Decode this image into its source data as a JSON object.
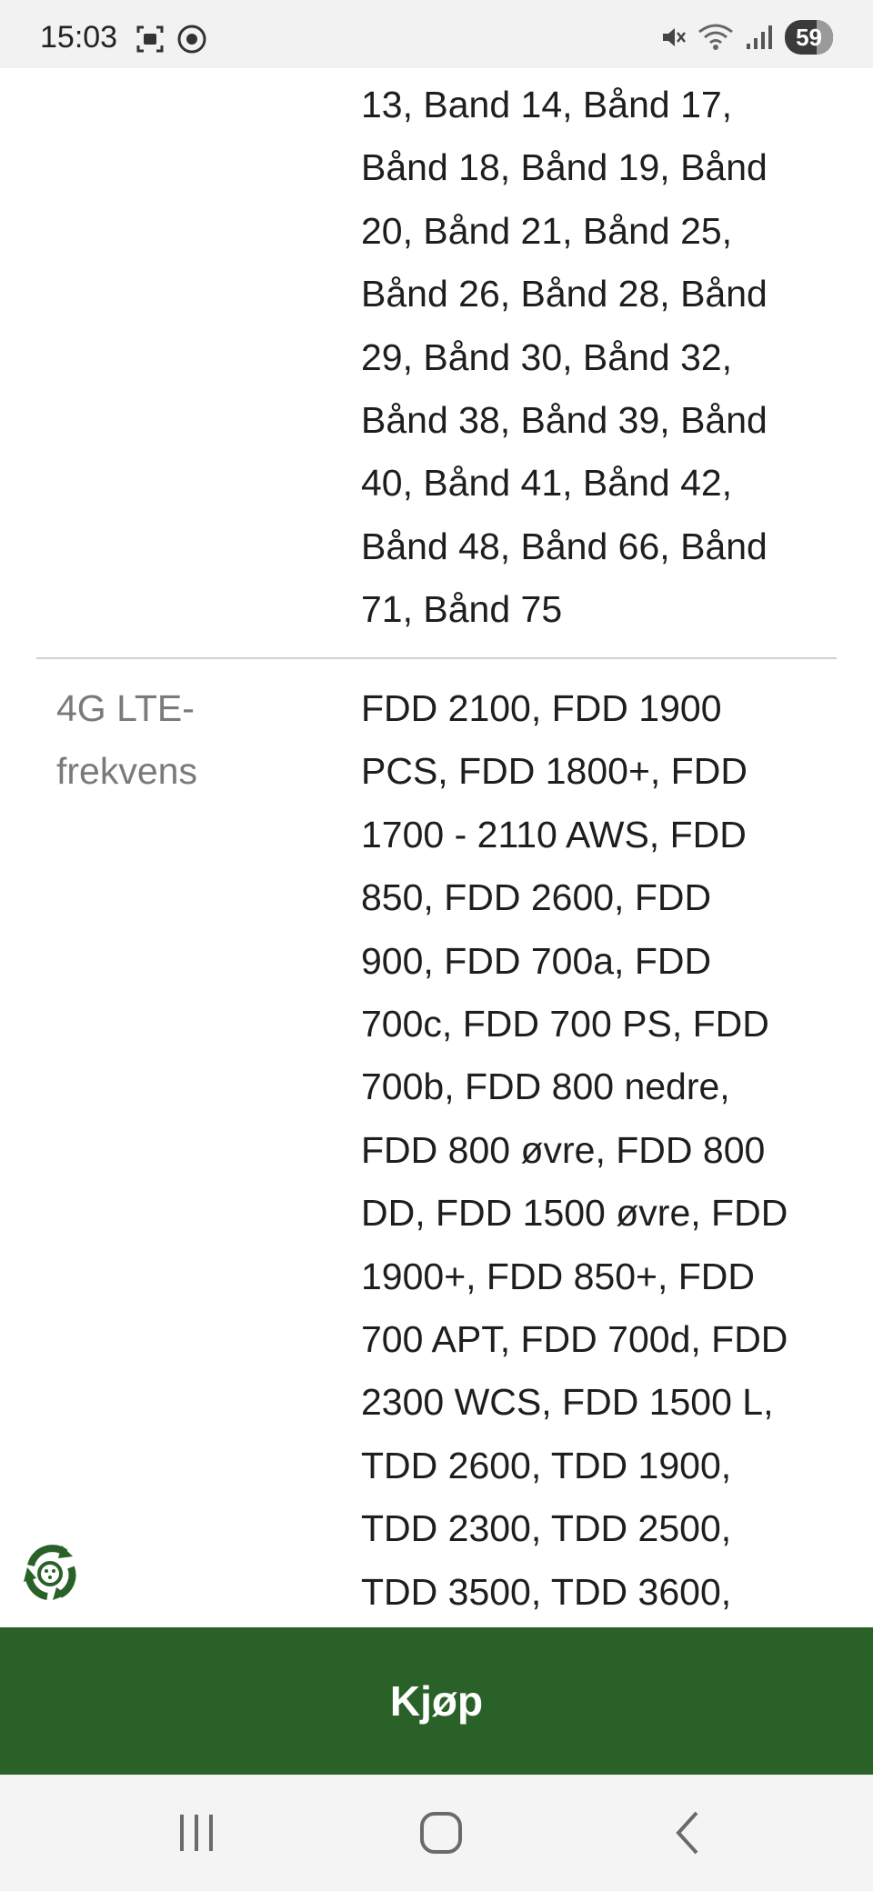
{
  "status_bar": {
    "time": "15:03",
    "battery": "59",
    "icons": [
      "screenshot-icon",
      "camera-icon",
      "mute-icon",
      "wifi-icon",
      "signal-icon"
    ]
  },
  "specs": {
    "bands_continued": "13, Band 14, Bånd 17,\nBånd 18, Bånd 19, Bånd\n20, Bånd 21, Bånd 25,\nBånd 26, Bånd 28, Bånd\n29, Bånd 30, Bånd 32,\nBånd 38, Bånd 39, Bånd\n40, Bånd 41, Bånd 42,\nBånd 48, Bånd 66, Bånd\n71, Bånd 75",
    "lte_label": "4G LTE-\nfrekvens",
    "lte_value": "FDD 2100, FDD 1900\nPCS, FDD 1800+, FDD\n1700 - 2110 AWS, FDD\n850, FDD 2600, FDD\n900, FDD 700a, FDD\n700c, FDD 700 PS, FDD\n700b, FDD 800 nedre,\nFDD 800 øvre, FDD 800\nDD, FDD 1500 øvre, FDD\n1900+, FDD 850+, FDD\n700 APT, FDD 700d, FDD\n2300 WCS, FDD 1500 L,\nTDD 2600, TDD 1900,\nTDD 2300, TDD 2500,\nTDD 3500, TDD 3600,"
  },
  "buy_button": {
    "label": "Kjøp"
  },
  "colors": {
    "brand_green": "#2a6128",
    "divider": "#d0d0d0",
    "label_gray": "#7a7a7a"
  },
  "nav": {
    "icons": [
      "recent-apps-icon",
      "home-icon",
      "back-icon"
    ]
  }
}
